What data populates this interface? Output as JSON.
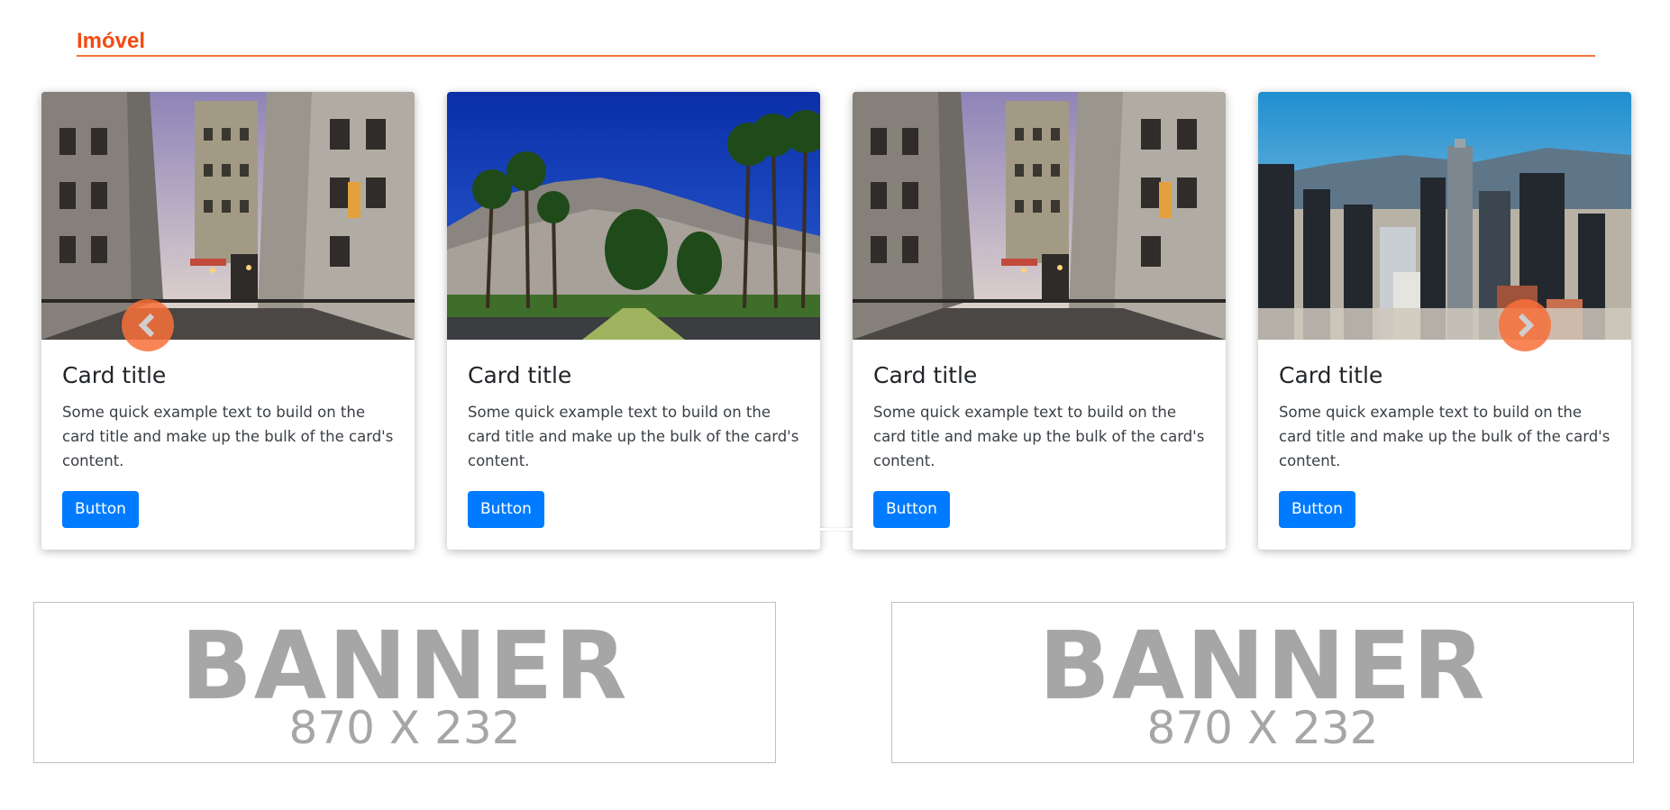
{
  "section": {
    "title": "Imóvel",
    "accent_color": "#f44b12"
  },
  "carousel": {
    "prev_icon": "chevron-left-icon",
    "next_icon": "chevron-right-icon",
    "cards": [
      {
        "image": "paris-street-photo",
        "title": "Card title",
        "text": "Some quick example text to build on the card title and make up the bulk of the card's content.",
        "button": "Button"
      },
      {
        "image": "palm-avenue-mountains-photo",
        "title": "Card title",
        "text": "Some quick example text to build on the card title and make up the bulk of the card's content.",
        "button": "Button"
      },
      {
        "image": "paris-street-photo",
        "title": "Card title",
        "text": "Some quick example text to build on the card title and make up the bulk of the card's content.",
        "button": "Button"
      },
      {
        "image": "city-skyline-photo",
        "title": "Card title",
        "text": "Some quick example text to build on the card title and make up the bulk of the card's content.",
        "button": "Button"
      }
    ],
    "button_color": "#007bff"
  },
  "banners": [
    {
      "word": "BANNER",
      "size": "870 X 232"
    },
    {
      "word": "BANNER",
      "size": "870 X 232"
    }
  ]
}
